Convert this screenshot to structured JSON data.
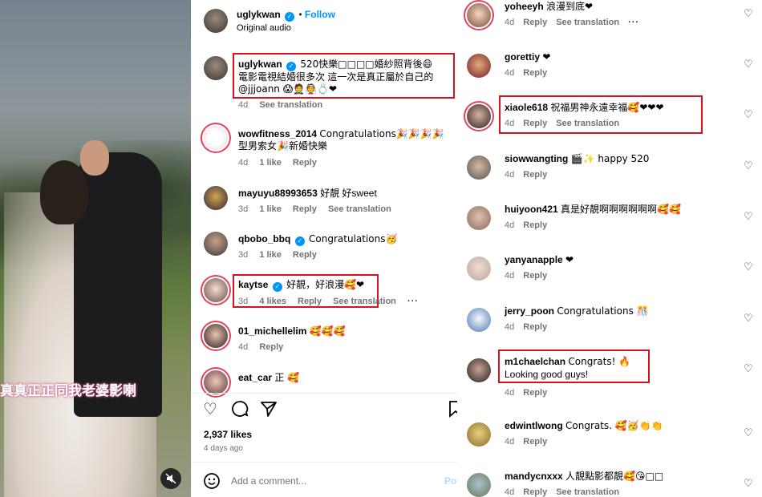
{
  "photo": {
    "overlay_caption": "真真正正同我老婆影喇"
  },
  "post": {
    "author": "uglykwan",
    "follow_label": "Follow",
    "audio": "Original audio",
    "likes": "2,937 likes",
    "time": "4 days ago",
    "add_comment_placeholder": "Add a comment...",
    "post_label": "Post"
  },
  "common": {
    "reply": "Reply",
    "see_translation": "See translation"
  },
  "mid_comments": [
    {
      "user": "uglykwan",
      "line1": "520快樂□□□□婚紗照背後😄",
      "line2": "電影電視結婚很多次 這一次是真正屬於自己的",
      "line3": "@jjjoann 😱🤵👰💍❤",
      "time": "4d",
      "see_translation": "See translation"
    },
    {
      "user": "wowfitness_2014",
      "line1": "Congratulations🎉🎉🎉🎉",
      "line2": "型男索女🎉新婚快樂",
      "time": "4d",
      "likes": "1 like",
      "reply": "Reply"
    },
    {
      "user": "mayuyu88993653",
      "line1": "好靚 好sweet",
      "time": "3d",
      "likes": "1 like",
      "reply": "Reply",
      "see_translation": "See translation"
    },
    {
      "user": "qbobo_bbq",
      "line1": "Congratulations🥳",
      "time": "3d",
      "likes": "1 like",
      "reply": "Reply"
    },
    {
      "user": "kaytse",
      "line1": "好靚，好浪漫🥰❤",
      "time": "3d",
      "likes": "4 likes",
      "reply": "Reply",
      "see_translation": "See translation"
    },
    {
      "user": "01_michellelim",
      "line1": "🥰🥰🥰",
      "time": "4d",
      "reply": "Reply"
    },
    {
      "user": "eat_car",
      "line1": "正 🥰"
    }
  ],
  "right_comments": [
    {
      "user": "yoheeyh",
      "line1": "浪漫到底❤",
      "time": "4d",
      "reply": "Reply",
      "see_translation": "See translation"
    },
    {
      "user": "gorettiy",
      "line1": "❤",
      "time": "4d",
      "reply": "Reply"
    },
    {
      "user": "xiaole618",
      "line1": "祝福男神永遠幸福🥰❤❤❤",
      "time": "4d",
      "reply": "Reply",
      "see_translation": "See translation"
    },
    {
      "user": "siowwangting",
      "line1": "🎬✨ happy 520",
      "time": "4d",
      "reply": "Reply"
    },
    {
      "user": "huiyoon421",
      "line1": "真是好靚啊啊啊啊啊啊🥰🥰",
      "time": "4d",
      "reply": "Reply"
    },
    {
      "user": "yanyanapple",
      "line1": "❤",
      "time": "4d",
      "reply": "Reply"
    },
    {
      "user": "jerry_poon",
      "line1": "Congratulations 🎊",
      "time": "4d",
      "reply": "Reply"
    },
    {
      "user": "m1chaelchan",
      "line1": "Congrats! 🔥",
      "line2": "Looking good guys!",
      "time": "4d",
      "reply": "Reply"
    },
    {
      "user": "edwintlwong",
      "line1": "Congrats. 🥰🥳👏👏",
      "time": "4d",
      "reply": "Reply"
    },
    {
      "user": "mandycnxxx",
      "line1": "人靚點影都靚🥰😘□□",
      "time": "4d",
      "reply": "Reply",
      "see_translation": "See translation"
    }
  ],
  "colors": {
    "link_blue": "#0095f6",
    "highlight_red": "#d7121f",
    "meta_gray": "#737373"
  },
  "icons": [
    "heart-icon",
    "comment-icon",
    "share-icon",
    "bookmark-icon",
    "emoji-icon",
    "mute-icon",
    "verified-icon",
    "more-icon"
  ]
}
